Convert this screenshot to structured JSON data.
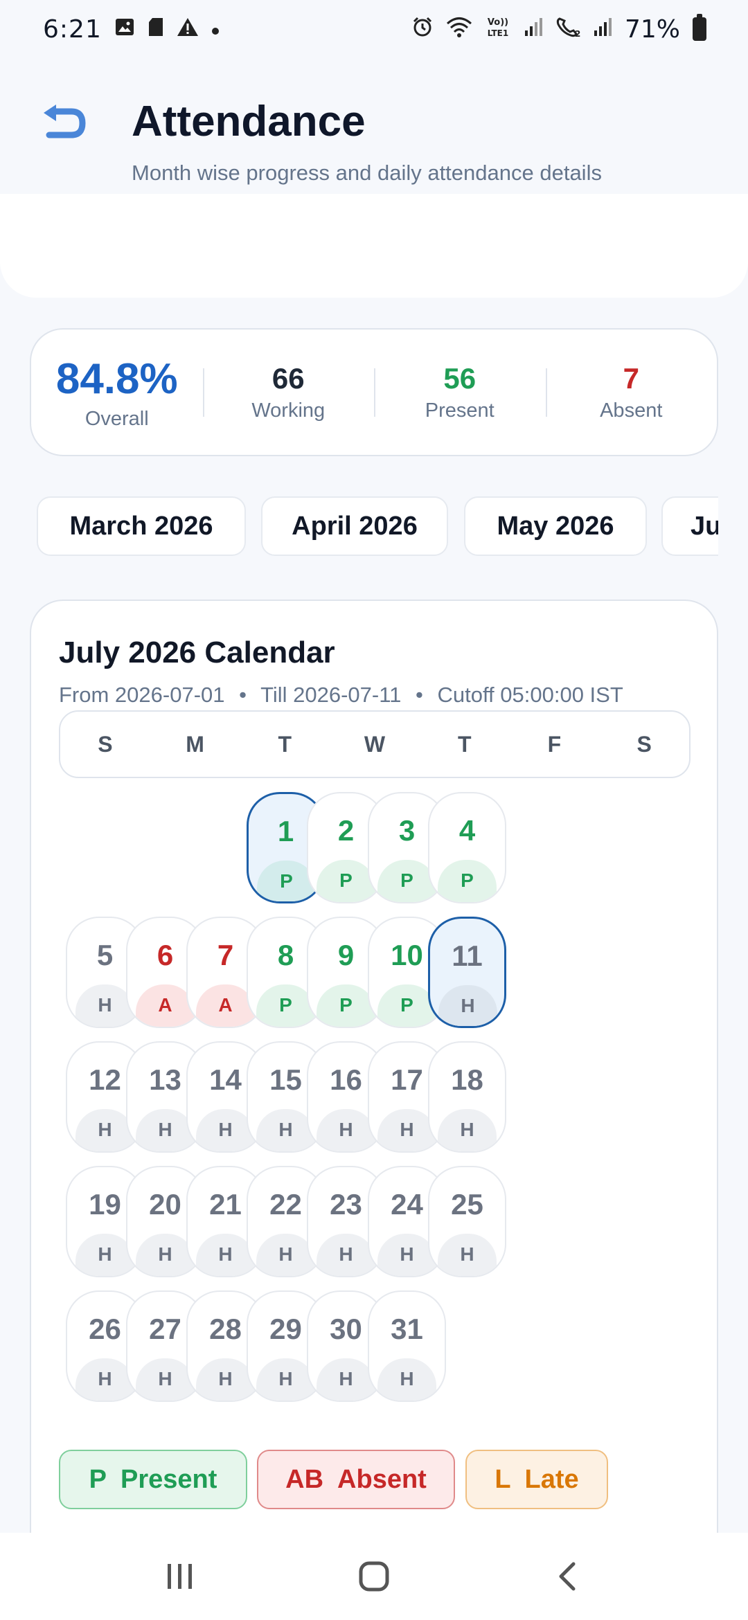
{
  "status_bar": {
    "time": "6:21",
    "battery": "71%"
  },
  "header": {
    "title": "Attendance",
    "subtitle": "Month wise progress and daily attendance details"
  },
  "summary": {
    "overall_value": "84.8%",
    "overall_label": "Overall",
    "working_value": "66",
    "working_label": "Working",
    "present_value": "56",
    "present_label": "Present",
    "absent_value": "7",
    "absent_label": "Absent"
  },
  "month_tabs": [
    "March 2026",
    "April 2026",
    "May 2026",
    "Ju"
  ],
  "calendar": {
    "title": "July 2026 Calendar",
    "from": "From 2026-07-01",
    "till": "Till 2026-07-11",
    "cutoff": "Cutoff 05:00:00 IST",
    "separator": "•",
    "weekdays": [
      "S",
      "M",
      "T",
      "W",
      "T",
      "F",
      "S"
    ],
    "start_weekday_index": 3,
    "days": [
      {
        "n": "1",
        "s": "P",
        "highlight": true
      },
      {
        "n": "2",
        "s": "P"
      },
      {
        "n": "3",
        "s": "P"
      },
      {
        "n": "4",
        "s": "P"
      },
      {
        "n": "5",
        "s": "H"
      },
      {
        "n": "6",
        "s": "A"
      },
      {
        "n": "7",
        "s": "A"
      },
      {
        "n": "8",
        "s": "P"
      },
      {
        "n": "9",
        "s": "P"
      },
      {
        "n": "10",
        "s": "P"
      },
      {
        "n": "11",
        "s": "H",
        "highlight": true
      },
      {
        "n": "12",
        "s": "H"
      },
      {
        "n": "13",
        "s": "H"
      },
      {
        "n": "14",
        "s": "H"
      },
      {
        "n": "15",
        "s": "H"
      },
      {
        "n": "16",
        "s": "H"
      },
      {
        "n": "17",
        "s": "H"
      },
      {
        "n": "18",
        "s": "H"
      },
      {
        "n": "19",
        "s": "H"
      },
      {
        "n": "20",
        "s": "H"
      },
      {
        "n": "21",
        "s": "H"
      },
      {
        "n": "22",
        "s": "H"
      },
      {
        "n": "23",
        "s": "H"
      },
      {
        "n": "24",
        "s": "H"
      },
      {
        "n": "25",
        "s": "H"
      },
      {
        "n": "26",
        "s": "H"
      },
      {
        "n": "27",
        "s": "H"
      },
      {
        "n": "28",
        "s": "H"
      },
      {
        "n": "29",
        "s": "H"
      },
      {
        "n": "30",
        "s": "H"
      },
      {
        "n": "31",
        "s": "H"
      }
    ]
  },
  "legend": {
    "present_code": "P",
    "present_label": "Present",
    "absent_code": "AB",
    "absent_label": "Absent",
    "late_code": "L",
    "late_label": "Late"
  },
  "colors": {
    "accent_blue": "#1d63c4",
    "present_green": "#1f9d55",
    "absent_red": "#c62828",
    "late_orange": "#d97706"
  },
  "icons": {
    "back": "undo-arrow-icon",
    "nav_recents": "recents-icon",
    "nav_home": "home-icon",
    "nav_back": "chevron-left-icon"
  }
}
